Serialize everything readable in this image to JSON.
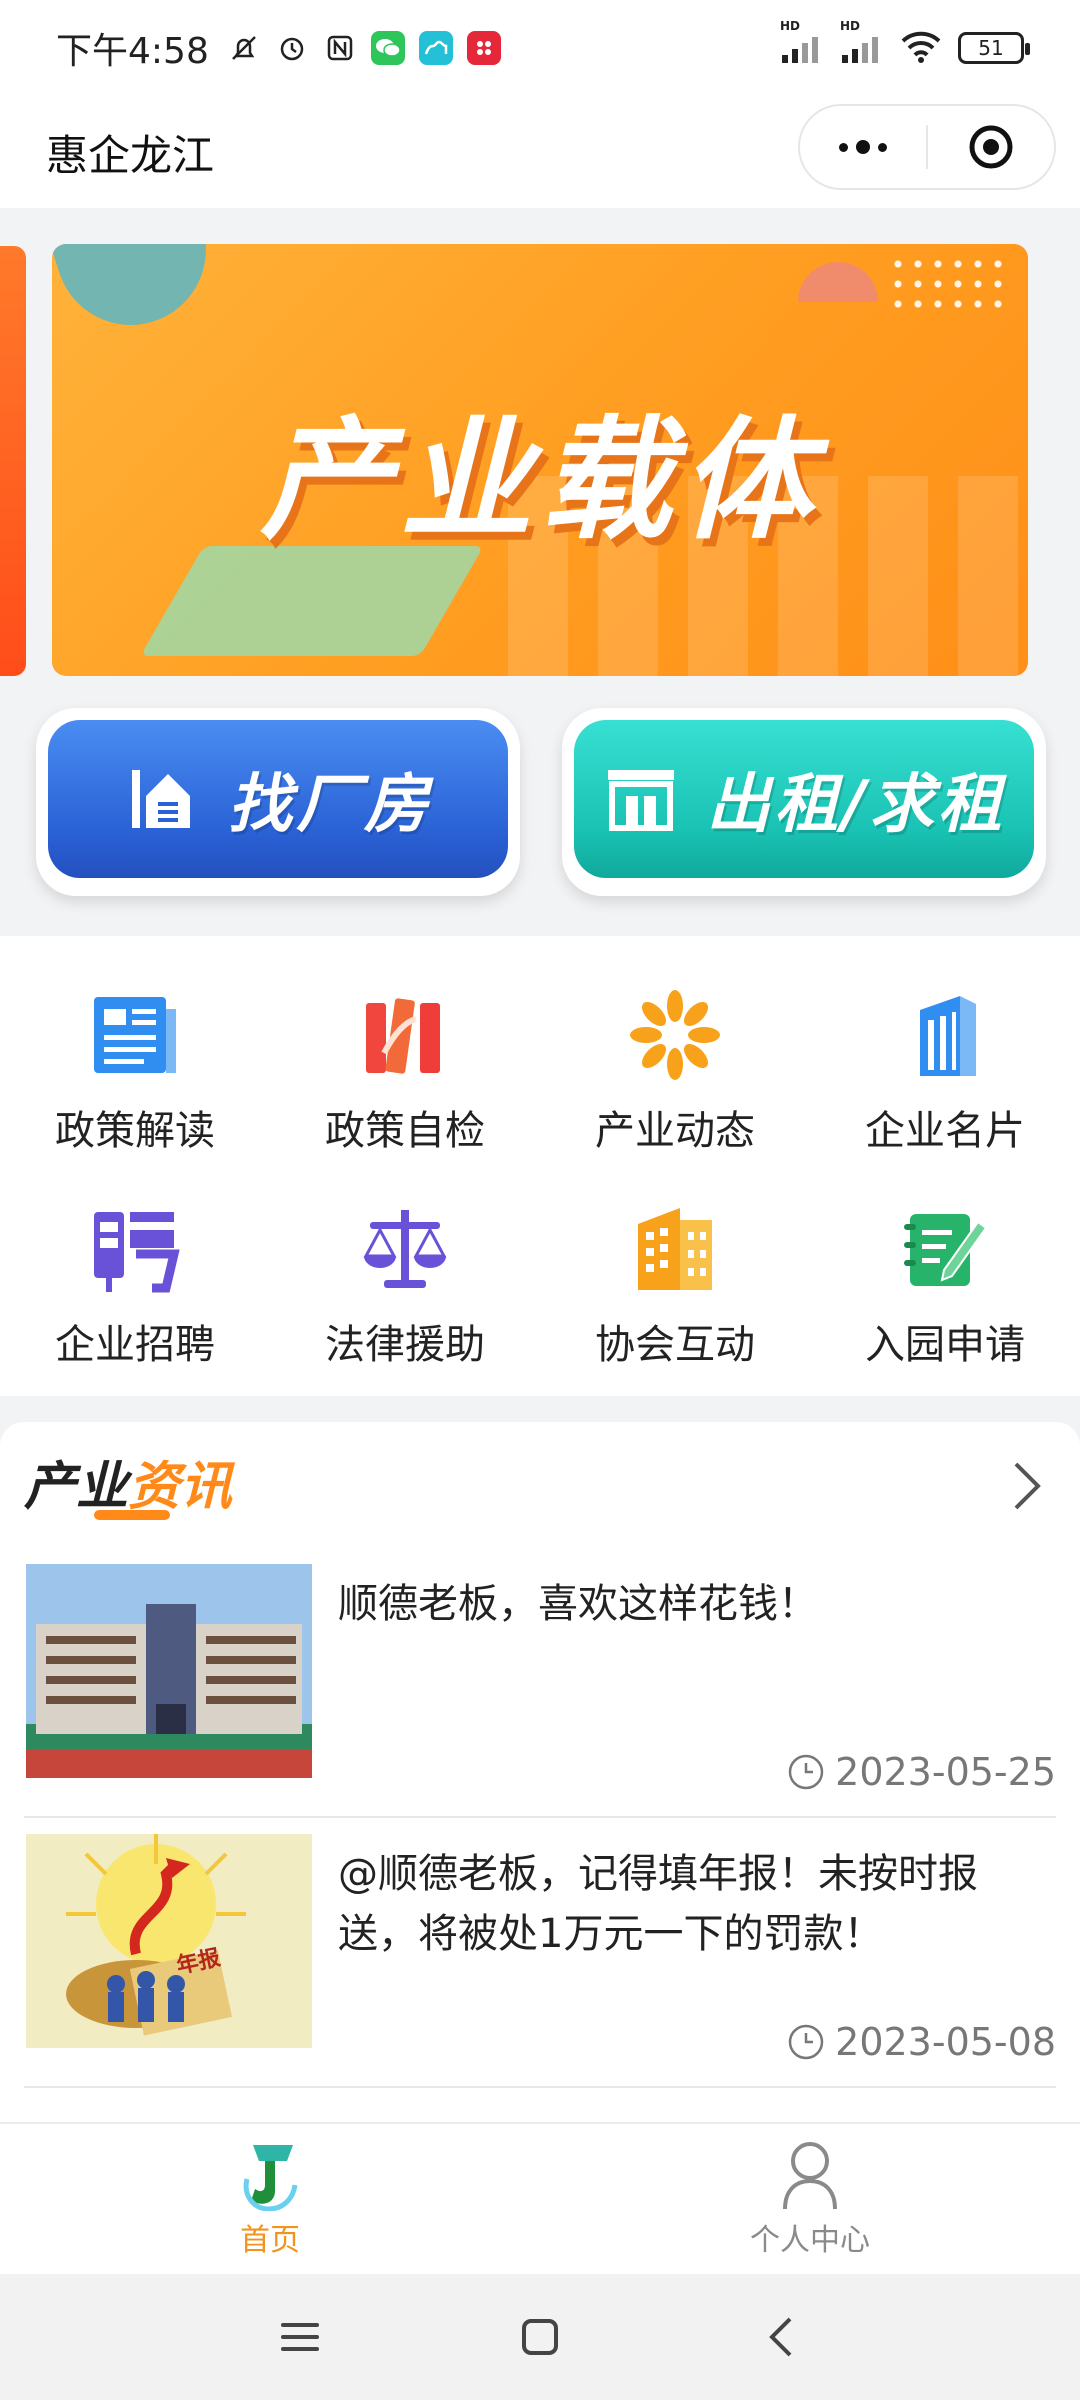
{
  "status_bar": {
    "time": "下午4:58",
    "battery": "51",
    "network_1": "HD",
    "network_2": "HD"
  },
  "nav": {
    "title": "惠企龙江"
  },
  "banner": {
    "title": "产业载体"
  },
  "quick_actions": [
    {
      "label": "找厂房",
      "icon": "factory-house-icon"
    },
    {
      "label": "出租/求租",
      "icon": "storefront-icon"
    }
  ],
  "menu": [
    {
      "label": "政策解读",
      "icon": "document-icon"
    },
    {
      "label": "政策自检",
      "icon": "books-icon"
    },
    {
      "label": "产业动态",
      "icon": "flower-icon"
    },
    {
      "label": "企业名片",
      "icon": "building-icon"
    },
    {
      "label": "企业招聘",
      "icon": "recruit-icon"
    },
    {
      "label": "法律援助",
      "icon": "scales-icon"
    },
    {
      "label": "协会互动",
      "icon": "office-building-icon"
    },
    {
      "label": "入园申请",
      "icon": "notebook-pen-icon"
    }
  ],
  "news": {
    "title_part1": "产业",
    "title_part2": "资讯",
    "items": [
      {
        "headline": "顺德老板，喜欢这样花钱！",
        "date": "2023-05-25"
      },
      {
        "headline": "@顺德老板，记得填年报！未按时报送，将被处1万元一下的罚款！",
        "date": "2023-05-08"
      }
    ],
    "thumb2_text": "年报"
  },
  "tabbar": {
    "home": "首页",
    "profile": "个人中心"
  },
  "colors": {
    "accent": "#f0941e",
    "banner_orange": "#ffa42a",
    "btn_blue": "#2a62d6",
    "btn_teal": "#19c2b3"
  }
}
